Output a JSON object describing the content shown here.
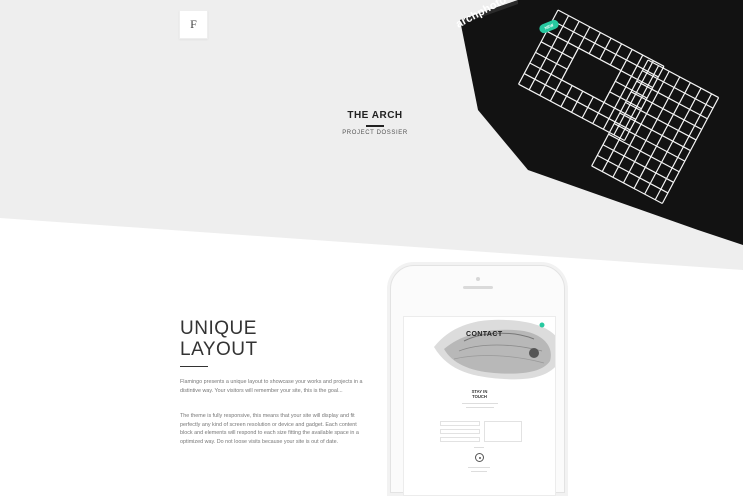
{
  "header": {
    "logo_letter": "F"
  },
  "project": {
    "title": "THE ARCH",
    "subtitle": "PROJECT DOSSIER"
  },
  "booklet": {
    "brand": "archphoto",
    "badge": "NEW"
  },
  "feature": {
    "heading_line1": "UNIQUE",
    "heading_line2": "LAYOUT",
    "paragraph1": "Flamingo presents a unique layout to showcase your works and projects in a distintive way. Your visitors will remember your site, this is the goal...",
    "paragraph2": "The theme is fully responsive, this means that your site will display and fit perfectly any kind of screen resolution or device and gadget. Each content block and elements will respond to each size fitting the available space in a optimized way. Do not loose visits because your site is out of date."
  },
  "phone_screen": {
    "contact_label": "CONTACT",
    "stay_line1": "STAY IN",
    "stay_line2": "TOUCH"
  },
  "colors": {
    "top_band": "#eeeeee",
    "accent_green": "#27c9a0",
    "booklet_black": "#121212"
  }
}
